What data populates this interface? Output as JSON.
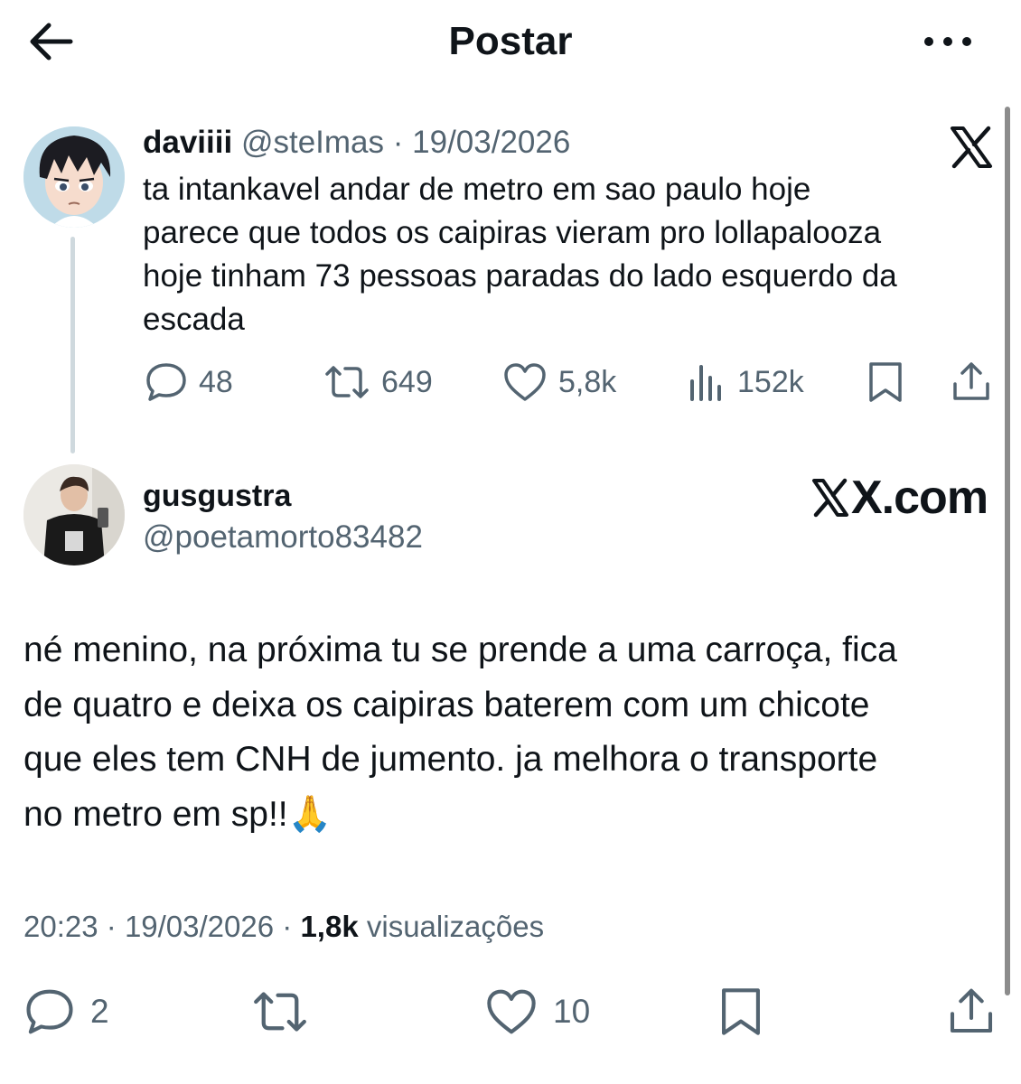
{
  "header": {
    "title": "Postar",
    "back_icon": "arrow-left-icon",
    "more_icon": "more-horizontal-icon"
  },
  "quoted_post": {
    "display_name": "daviiii",
    "handle": "@steImas",
    "separator": "·",
    "date": "19/03/2026",
    "lines": [
      "ta intankavel andar de metro em sao paulo hoje",
      "parece que todos os caipiras vieram pro lollapalooza",
      "hoje tinham 73 pessoas paradas do lado esquerdo da",
      "escada"
    ],
    "stats": {
      "replies": "48",
      "reposts": "649",
      "likes": "5,8k",
      "views": "152k"
    },
    "brand_icon": "x-logo-icon"
  },
  "reply_post": {
    "display_name": "gusgustra",
    "handle": "@poetamorto83482",
    "brand_text": "X.com",
    "lines": [
      "né menino, na próxima tu se prende a uma carroça, fica",
      "de quatro e deixa os caipiras baterem com um chicote",
      "que eles tem CNH de jumento. ja melhora o transporte",
      "no metro em sp!!"
    ],
    "emoji": "🙏",
    "time": "20:23",
    "separator": "·",
    "date": "19/03/2026",
    "views_count": "1,8k",
    "views_label": "visualizações",
    "actions": {
      "replies": "2",
      "likes": "10"
    }
  },
  "colors": {
    "text": "#0f1419",
    "muted": "#536471",
    "divider": "#cfd9de",
    "background": "#ffffff"
  }
}
